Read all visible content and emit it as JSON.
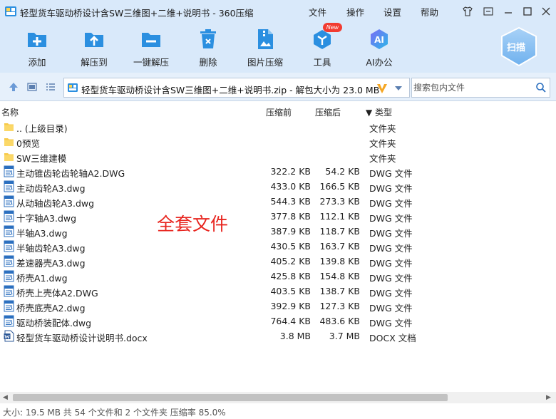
{
  "window": {
    "title": "轻型货车驱动桥设计含SW三维图+二维+说明书 - 360压缩",
    "menu": [
      "文件",
      "操作",
      "设置",
      "帮助"
    ]
  },
  "toolbar": {
    "items": [
      {
        "label": "添加",
        "icon": "add-icon"
      },
      {
        "label": "解压到",
        "icon": "extract-to-icon"
      },
      {
        "label": "一键解压",
        "icon": "one-click-extract-icon"
      },
      {
        "label": "删除",
        "icon": "delete-icon"
      },
      {
        "label": "图片压缩",
        "icon": "image-compress-icon"
      },
      {
        "label": "工具",
        "icon": "tools-icon",
        "badge": "New"
      },
      {
        "label": "AI办公",
        "icon": "ai-office-icon",
        "icon_text": "AI"
      }
    ],
    "scan_label": "扫描"
  },
  "address": {
    "path": "轻型货车驱动桥设计含SW三维图+二维+说明书.zip - 解包大小为 23.0 MB",
    "search_placeholder": "搜索包内文件"
  },
  "columns": {
    "name": "名称",
    "packed": "压缩前",
    "compressed": "压缩后",
    "type": "▼ 类型"
  },
  "files": [
    {
      "name": ".. (上级目录)",
      "packed": "",
      "compressed": "",
      "type": "文件夹",
      "kind": "folder"
    },
    {
      "name": "0预览",
      "packed": "",
      "compressed": "",
      "type": "文件夹",
      "kind": "folder"
    },
    {
      "name": "SW三维建模",
      "packed": "",
      "compressed": "",
      "type": "文件夹",
      "kind": "folder"
    },
    {
      "name": "主动锥齿轮齿轮轴A2.DWG",
      "packed": "322.2 KB",
      "compressed": "54.2 KB",
      "type": "DWG 文件",
      "kind": "dwg"
    },
    {
      "name": "主动齿轮A3.dwg",
      "packed": "433.0 KB",
      "compressed": "166.5 KB",
      "type": "DWG 文件",
      "kind": "dwg"
    },
    {
      "name": "从动轴齿轮A3.dwg",
      "packed": "544.3 KB",
      "compressed": "273.3 KB",
      "type": "DWG 文件",
      "kind": "dwg"
    },
    {
      "name": "十字轴A3.dwg",
      "packed": "377.8 KB",
      "compressed": "112.1 KB",
      "type": "DWG 文件",
      "kind": "dwg"
    },
    {
      "name": "半轴A3.dwg",
      "packed": "387.9 KB",
      "compressed": "118.7 KB",
      "type": "DWG 文件",
      "kind": "dwg"
    },
    {
      "name": "半轴齿轮A3.dwg",
      "packed": "430.5 KB",
      "compressed": "163.7 KB",
      "type": "DWG 文件",
      "kind": "dwg"
    },
    {
      "name": "差速器壳A3.dwg",
      "packed": "405.2 KB",
      "compressed": "139.8 KB",
      "type": "DWG 文件",
      "kind": "dwg"
    },
    {
      "name": "桥壳A1.dwg",
      "packed": "425.8 KB",
      "compressed": "154.8 KB",
      "type": "DWG 文件",
      "kind": "dwg"
    },
    {
      "name": "桥壳上壳体A2.DWG",
      "packed": "403.5 KB",
      "compressed": "138.7 KB",
      "type": "DWG 文件",
      "kind": "dwg"
    },
    {
      "name": "桥壳底壳A2.dwg",
      "packed": "392.9 KB",
      "compressed": "127.3 KB",
      "type": "DWG 文件",
      "kind": "dwg"
    },
    {
      "name": "驱动桥装配体.dwg",
      "packed": "764.4 KB",
      "compressed": "483.6 KB",
      "type": "DWG 文件",
      "kind": "dwg"
    },
    {
      "name": "轻型货车驱动桥设计说明书.docx",
      "packed": "3.8 MB",
      "compressed": "3.7 MB",
      "type": "DOCX 文档",
      "kind": "docx"
    }
  ],
  "overlay_text": "全套文件",
  "status": "大小: 19.5 MB 共 54 个文件和 2 个文件夹 压缩率 85.0%",
  "colors": {
    "chrome": "#d9e9fa",
    "accent": "#2b8fe0",
    "overlay": "#e8251f"
  }
}
